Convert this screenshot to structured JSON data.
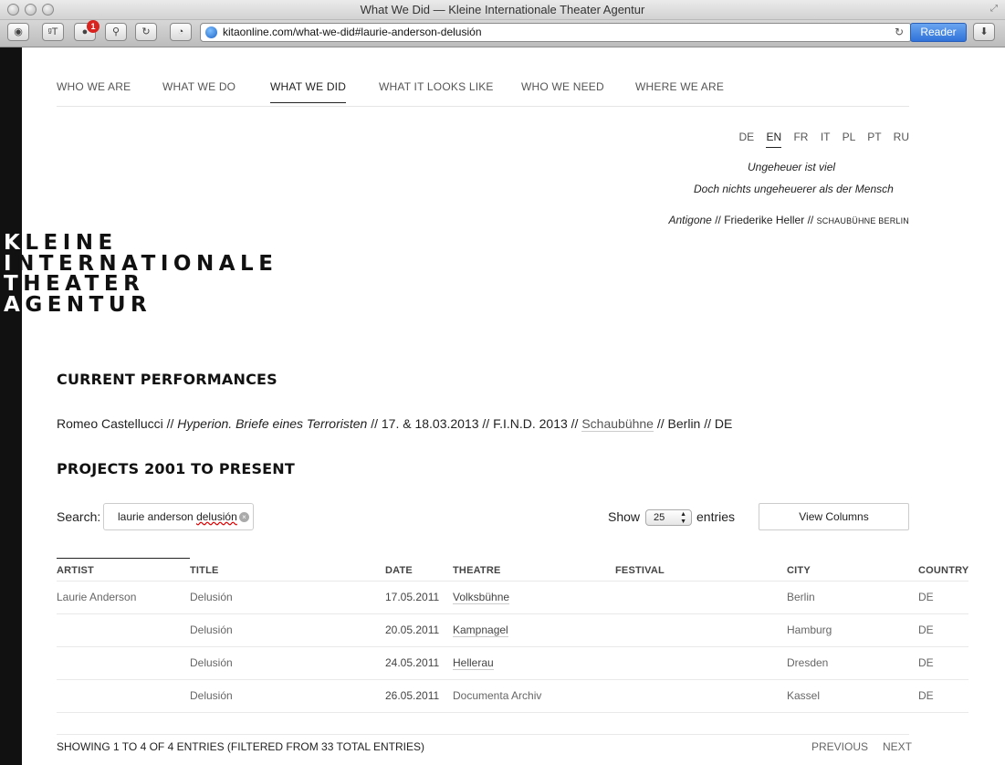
{
  "window": {
    "title": "What We Did — Kleine Internationale Theater Agentur"
  },
  "browser": {
    "url": "kitaonline.com/what-we-did#laurie-anderson-delusión",
    "reader_label": "Reader",
    "notification_count": "1"
  },
  "nav": {
    "items": [
      "WHO WE ARE",
      "WHAT WE DO",
      "WHAT WE DID",
      "WHAT IT LOOKS LIKE",
      "WHO WE NEED",
      "WHERE WE ARE"
    ],
    "active": "WHAT WE DID"
  },
  "languages": {
    "items": [
      "DE",
      "EN",
      "FR",
      "IT",
      "PL",
      "PT",
      "RU"
    ],
    "active": "EN"
  },
  "quote": {
    "line1": "Ungeheuer ist viel",
    "line2": "Doch nichts ungeheuerer als der Mensch",
    "work": "Antigone",
    "separator": " // ",
    "author": "Friederike Heller",
    "theatre": "SCHAUBÜHNE BERLIN"
  },
  "logo": {
    "rows": [
      {
        "first": "K",
        "rest": "LEINE"
      },
      {
        "first": "I",
        "rest": "NTERNATIONALE"
      },
      {
        "first": "T",
        "rest": "HEATER"
      },
      {
        "first": "A",
        "rest": "GENTUR"
      }
    ]
  },
  "current": {
    "heading": "CURRENT PERFORMANCES",
    "artist": "Romeo Castellucci",
    "sep": " // ",
    "title": "Hyperion. Briefe eines Terroristen",
    "details": " // 17. & 18.03.2013 // F.I.N.D. 2013 // ",
    "theatre": "Schaubühne",
    "tail": " // Berlin // DE"
  },
  "projects": {
    "heading": "PROJECTS 2001 TO PRESENT",
    "search_label": "Search:",
    "search_value_plain": "laurie anderson ",
    "search_value_misspelled": "delusión",
    "show_label": "Show",
    "show_value": "25",
    "entries_label": "entries",
    "view_columns_label": "View Columns",
    "columns": [
      "ARTIST",
      "TITLE",
      "DATE",
      "THEATRE",
      "FESTIVAL",
      "CITY",
      "COUNTRY"
    ],
    "rows": [
      {
        "artist": "Laurie Anderson",
        "title": "Delusión",
        "date": "17.05.2011",
        "theatre": "Volksbühne",
        "festival": "",
        "city": "Berlin",
        "country": "DE"
      },
      {
        "artist": "",
        "title": "Delusión",
        "date": "20.05.2011",
        "theatre": "Kampnagel",
        "festival": "",
        "city": "Hamburg",
        "country": "DE"
      },
      {
        "artist": "",
        "title": "Delusión",
        "date": "24.05.2011",
        "theatre": "Hellerau",
        "festival": "",
        "city": "Dresden",
        "country": "DE"
      },
      {
        "artist": "",
        "title": "Delusión",
        "date": "26.05.2011",
        "theatre": "Documenta Archiv",
        "festival": "",
        "city": "Kassel",
        "country": "DE"
      }
    ],
    "info": "SHOWING 1 TO 4 OF 4 ENTRIES (FILTERED FROM 33 TOTAL ENTRIES)",
    "previous_label": "PREVIOUS",
    "next_label": "NEXT"
  }
}
